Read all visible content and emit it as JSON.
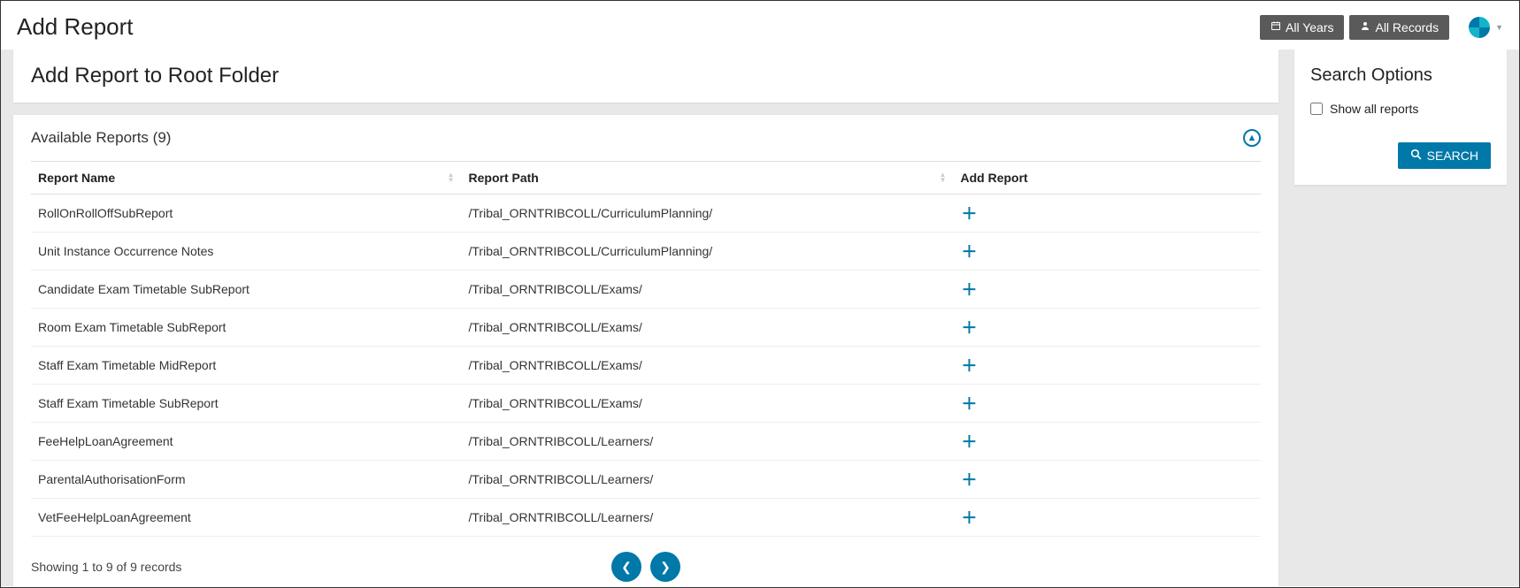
{
  "header": {
    "page_title": "Add Report",
    "all_years_label": "All Years",
    "all_records_label": "All Records"
  },
  "main": {
    "card_title": "Add Report to Root Folder",
    "section_title": "Available Reports (9)",
    "columns": {
      "name": "Report Name",
      "path": "Report Path",
      "add": "Add Report"
    },
    "rows": [
      {
        "name": "RollOnRollOffSubReport",
        "path": "/Tribal_ORNTRIBCOLL/CurriculumPlanning/"
      },
      {
        "name": "Unit Instance Occurrence Notes",
        "path": "/Tribal_ORNTRIBCOLL/CurriculumPlanning/"
      },
      {
        "name": "Candidate Exam Timetable SubReport",
        "path": "/Tribal_ORNTRIBCOLL/Exams/"
      },
      {
        "name": "Room Exam Timetable SubReport",
        "path": "/Tribal_ORNTRIBCOLL/Exams/"
      },
      {
        "name": "Staff Exam Timetable MidReport",
        "path": "/Tribal_ORNTRIBCOLL/Exams/"
      },
      {
        "name": "Staff Exam Timetable SubReport",
        "path": "/Tribal_ORNTRIBCOLL/Exams/"
      },
      {
        "name": "FeeHelpLoanAgreement",
        "path": "/Tribal_ORNTRIBCOLL/Learners/"
      },
      {
        "name": "ParentalAuthorisationForm",
        "path": "/Tribal_ORNTRIBCOLL/Learners/"
      },
      {
        "name": "VetFeeHelpLoanAgreement",
        "path": "/Tribal_ORNTRIBCOLL/Learners/"
      }
    ],
    "records_info": "Showing 1 to 9 of 9 records"
  },
  "side": {
    "title": "Search Options",
    "show_all_label": "Show all reports",
    "search_button": "SEARCH"
  }
}
